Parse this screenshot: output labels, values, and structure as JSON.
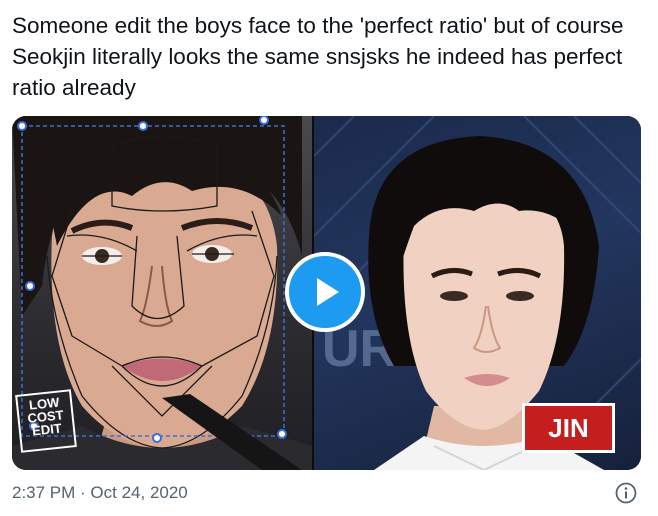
{
  "tweet": {
    "text": "Someone edit the boys face to the 'perfect ratio' but of course Seokjin literally looks the same snsjsks he indeed has perfect ratio already",
    "timestamp": "2:37 PM · Oct 24, 2020"
  },
  "media": {
    "watermark": [
      "LOW",
      "COST",
      "EDIT"
    ],
    "name_badge": "JIN",
    "play_icon": "play-icon",
    "info_icon": "info-icon"
  },
  "colors": {
    "accent": "#1d9bf0",
    "badge": "#c41e1e",
    "meta_text": "#536471"
  }
}
